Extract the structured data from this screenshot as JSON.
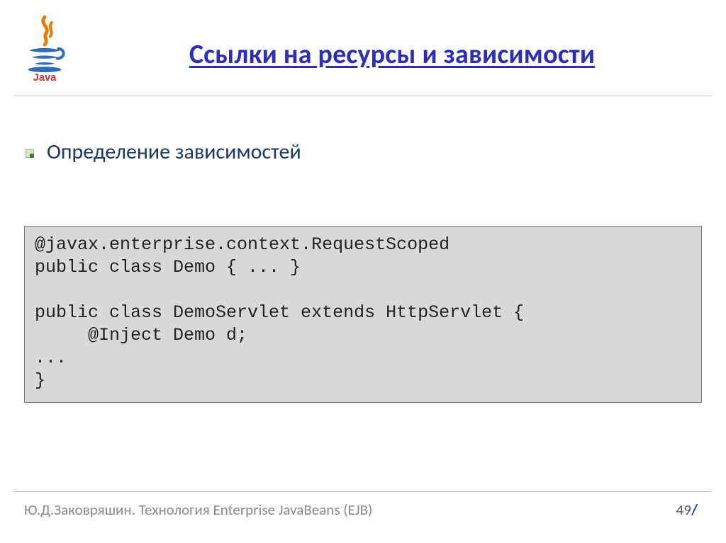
{
  "title": "Ссылки на ресурсы и зависимости",
  "bullet": "Определение зависимостей",
  "code": "@javax.enterprise.context.RequestScoped\npublic class Demo { ... }\n\npublic class DemoServlet extends HttpServlet {\n     @Inject Demo d;\n...\n}",
  "footer_text": "Ю.Д.Заковряшин. Технология Enterprise JavaBeans (EJB)",
  "page_number": "49",
  "page_slash": "/"
}
